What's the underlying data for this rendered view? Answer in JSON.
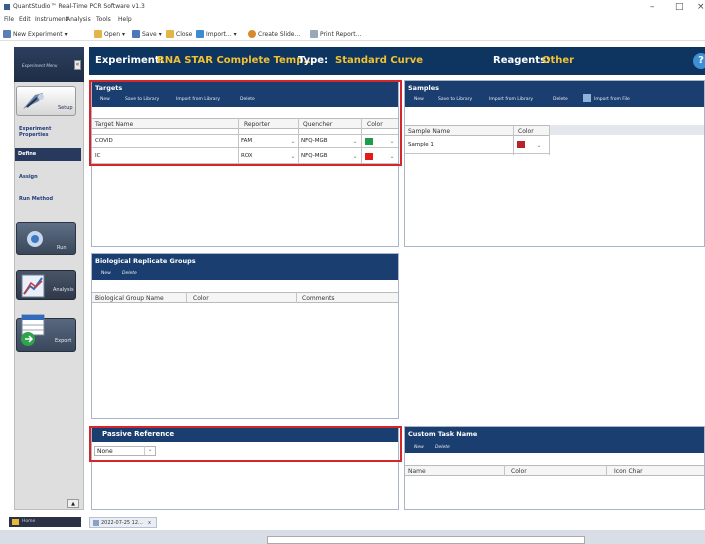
{
  "window": {
    "title": "QuantStudio™ Real-Time PCR Software v1.3",
    "controls": {
      "minimize": "–",
      "maximize": "□",
      "close": "×"
    }
  },
  "menu": [
    "File",
    "Edit",
    "Instrument",
    "Analysis",
    "Tools",
    "Help"
  ],
  "toolbar": {
    "new_experiment": "New Experiment",
    "open": "Open",
    "save": "Save",
    "close": "Close",
    "import": "Import...",
    "create_slide": "Create Slide...",
    "print_report": "Print Report..."
  },
  "nav": {
    "menu_label": "Experiment Menu",
    "collapse": "«",
    "setup": "Setup",
    "setup_items": [
      "Experiment Properties",
      "Define",
      "Assign",
      "Run Method"
    ],
    "selected_item": "Define",
    "run": "Run",
    "analysis": "Analysis",
    "export": "Export",
    "scroll_up": "▲"
  },
  "header": {
    "experiment_label": "Experiment:",
    "experiment_name": "RNA STAR Complete Temp...",
    "type_label": "Type:",
    "type_value": "Standard Curve",
    "reagents_label": "Reagents:",
    "reagents_value": "Other",
    "help": "?"
  },
  "targets": {
    "title": "Targets",
    "buttons": [
      "New",
      "Save to Library",
      "Import from Library",
      "Delete"
    ],
    "columns": [
      "Target Name",
      "Reporter",
      "Quencher",
      "Color"
    ],
    "rows": [
      {
        "name": "COVID",
        "reporter": "FAM",
        "quencher": "NFQ-MGB",
        "color": "#1e9b4b"
      },
      {
        "name": "IC",
        "reporter": "ROX",
        "quencher": "NFQ-MGB",
        "color": "#e01b1b"
      }
    ]
  },
  "samples": {
    "title": "Samples",
    "buttons": [
      "New",
      "Save to Library",
      "Import from Library",
      "Delete",
      "Import from File"
    ],
    "columns": [
      "Sample Name",
      "Color"
    ],
    "rows": [
      {
        "name": "Sample 1",
        "color": "#b8222e"
      }
    ]
  },
  "bio_groups": {
    "title": "Biological Replicate Groups",
    "buttons": [
      "New",
      "Delete"
    ],
    "columns": [
      "Biological Group Name",
      "Color",
      "Comments"
    ]
  },
  "passive_reference": {
    "title": "Passive Reference",
    "value": "None"
  },
  "custom_task": {
    "title": "Custom Task Name",
    "buttons": [
      "New",
      "Delete"
    ],
    "columns": [
      "Name",
      "Color",
      "Icon Char"
    ]
  },
  "status": {
    "home_tab": "Home",
    "doc_tab": "2022-07-25 12...",
    "doc_close": "x"
  },
  "colors": {
    "header_bg": "#0e3460",
    "panel_head_bg": "#1b3e70",
    "accent_yellow": "#f2c231",
    "highlight_red": "#d5262c"
  }
}
